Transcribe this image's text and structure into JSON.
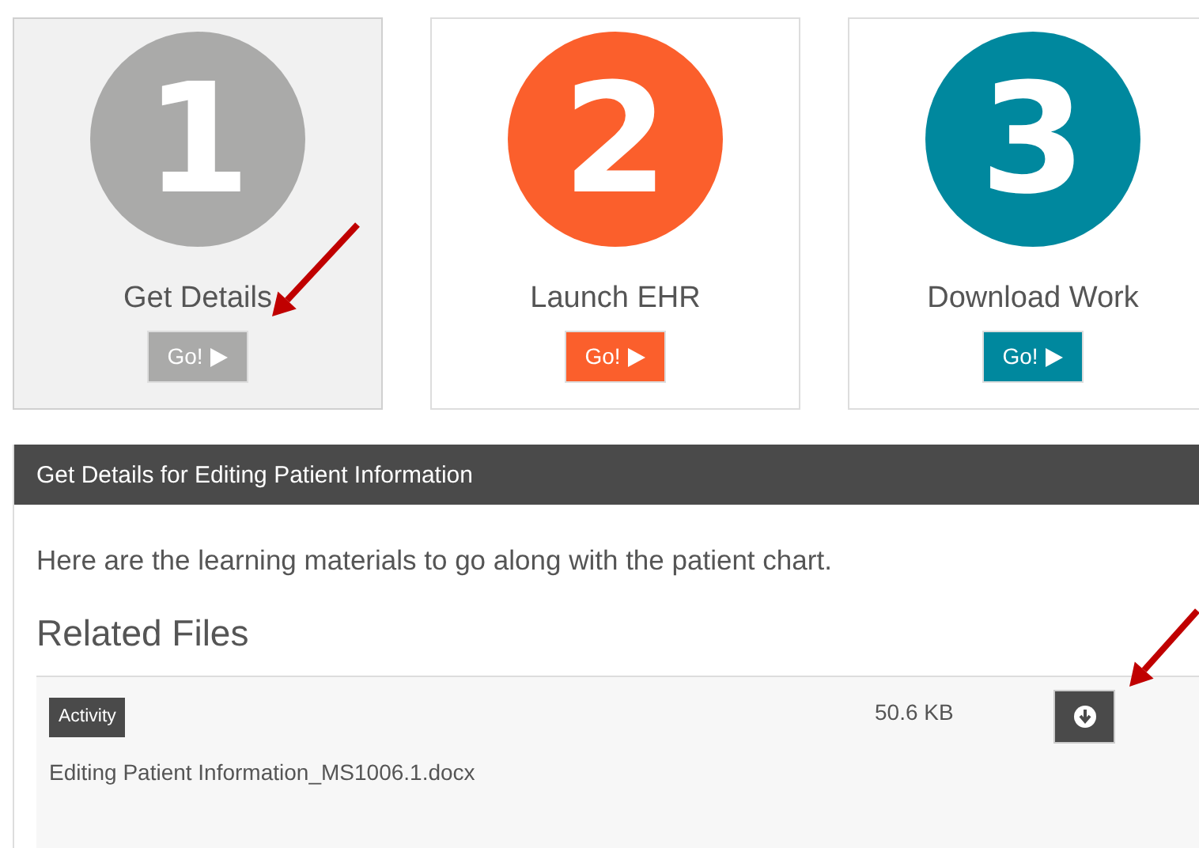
{
  "steps": [
    {
      "number": "1",
      "label": "Get Details",
      "button": "Go!",
      "color": "#aaaaa9",
      "selected": true
    },
    {
      "number": "2",
      "label": "Launch EHR",
      "button": "Go!",
      "color": "#fb5f2c",
      "selected": false
    },
    {
      "number": "3",
      "label": "Download Work",
      "button": "Go!",
      "color": "#00889e",
      "selected": false
    }
  ],
  "panel": {
    "title": "Get Details for Editing Patient Information",
    "intro": "Here are the learning materials to go along with the patient chart.",
    "heading": "Related Files",
    "files": [
      {
        "tag": "Activity",
        "name": "Editing Patient Information_MS1006.1.docx",
        "size": "50.6 KB"
      }
    ]
  }
}
